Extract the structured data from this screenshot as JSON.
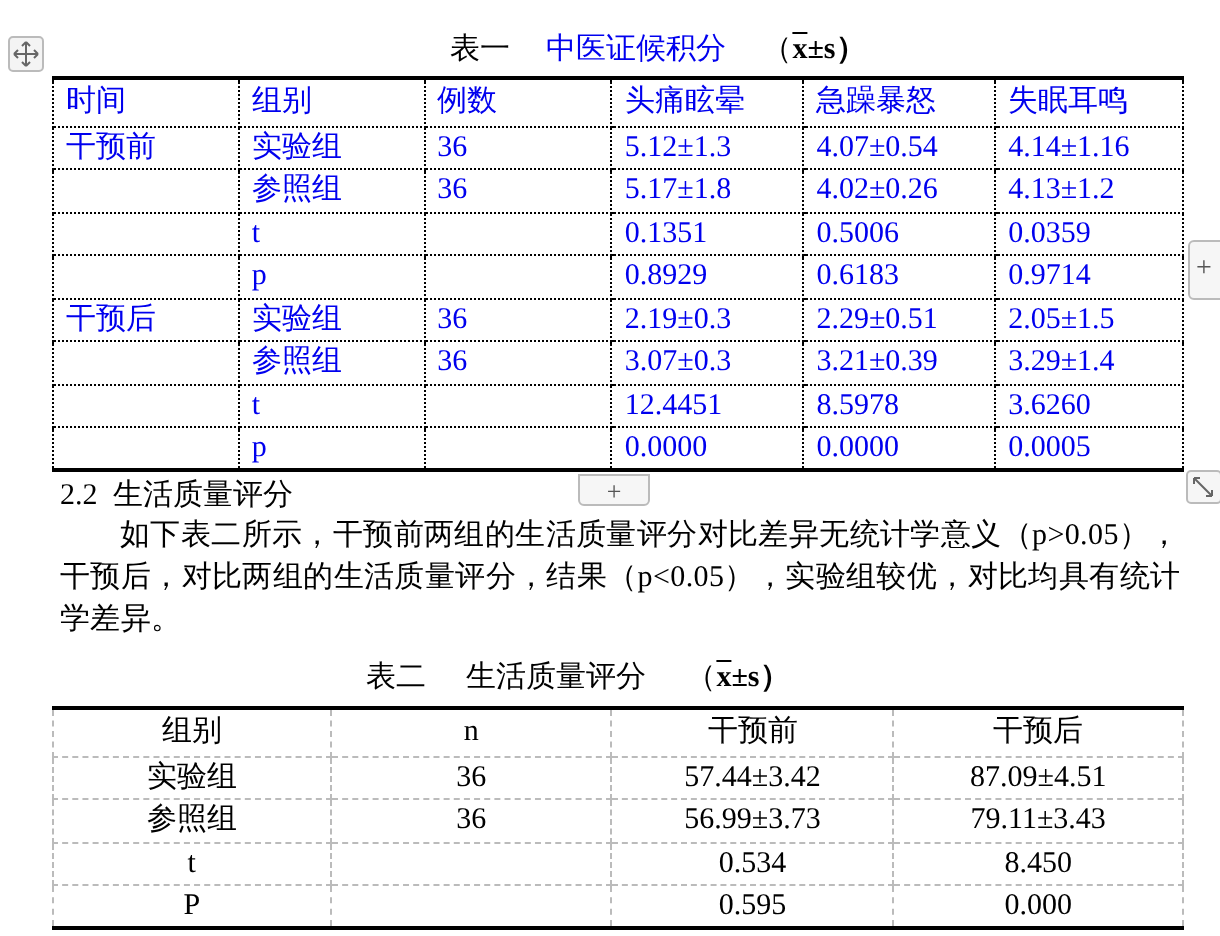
{
  "table1": {
    "label": "表一",
    "name": "中医证候积分",
    "stat_open": "（",
    "stat_mean": "x",
    "stat_rest": "±s）",
    "columns": [
      "时间",
      "组别",
      "例数",
      "头痛眩晕",
      "急躁暴怒",
      "失眠耳鸣"
    ],
    "rows": [
      [
        "干预前",
        "实验组",
        "36",
        "5.12±1.3",
        "4.07±0.54",
        "4.14±1.16"
      ],
      [
        null,
        "参照组",
        "36",
        "5.17±1.8",
        "4.02±0.26",
        "4.13±1.2"
      ],
      [
        null,
        "t",
        null,
        "0.1351",
        "0.5006",
        "0.0359"
      ],
      [
        null,
        "p",
        null,
        "0.8929",
        "0.6183",
        "0.9714"
      ],
      [
        "干预后",
        "实验组",
        "36",
        "2.19±0.3",
        "2.29±0.51",
        "2.05±1.5"
      ],
      [
        null,
        "参照组",
        "36",
        "3.07±0.3",
        "3.21±0.39",
        "3.29±1.4"
      ],
      [
        null,
        "t",
        null,
        "12.4451",
        "8.5978",
        "3.6260"
      ],
      [
        null,
        "p",
        null,
        "0.0000",
        "0.0000",
        "0.0005"
      ]
    ]
  },
  "add_row_button": "+",
  "add_column_button": "+",
  "section_heading": "2.2  生活质量评分",
  "paragraph": "如下表二所示，干预前两组的生活质量评分对比差异无统计学意义（p>0.05），干预后，对比两组的生活质量评分，结果（p<0.05），实验组较优，对比均具有统计学差异。",
  "table2": {
    "label": "表二",
    "name": "生活质量评分",
    "stat_open": "（",
    "stat_mean": "x",
    "stat_rest": "±s）",
    "columns": [
      "组别",
      "n",
      "干预前",
      "干预后"
    ],
    "rows": [
      [
        "实验组",
        "36",
        "57.44±3.42",
        "87.09±4.51"
      ],
      [
        "参照组",
        "36",
        "56.99±3.73",
        "79.11±3.43"
      ],
      [
        "t",
        null,
        "0.534",
        "8.450"
      ],
      [
        "P",
        null,
        "0.595",
        "0.000"
      ]
    ]
  }
}
